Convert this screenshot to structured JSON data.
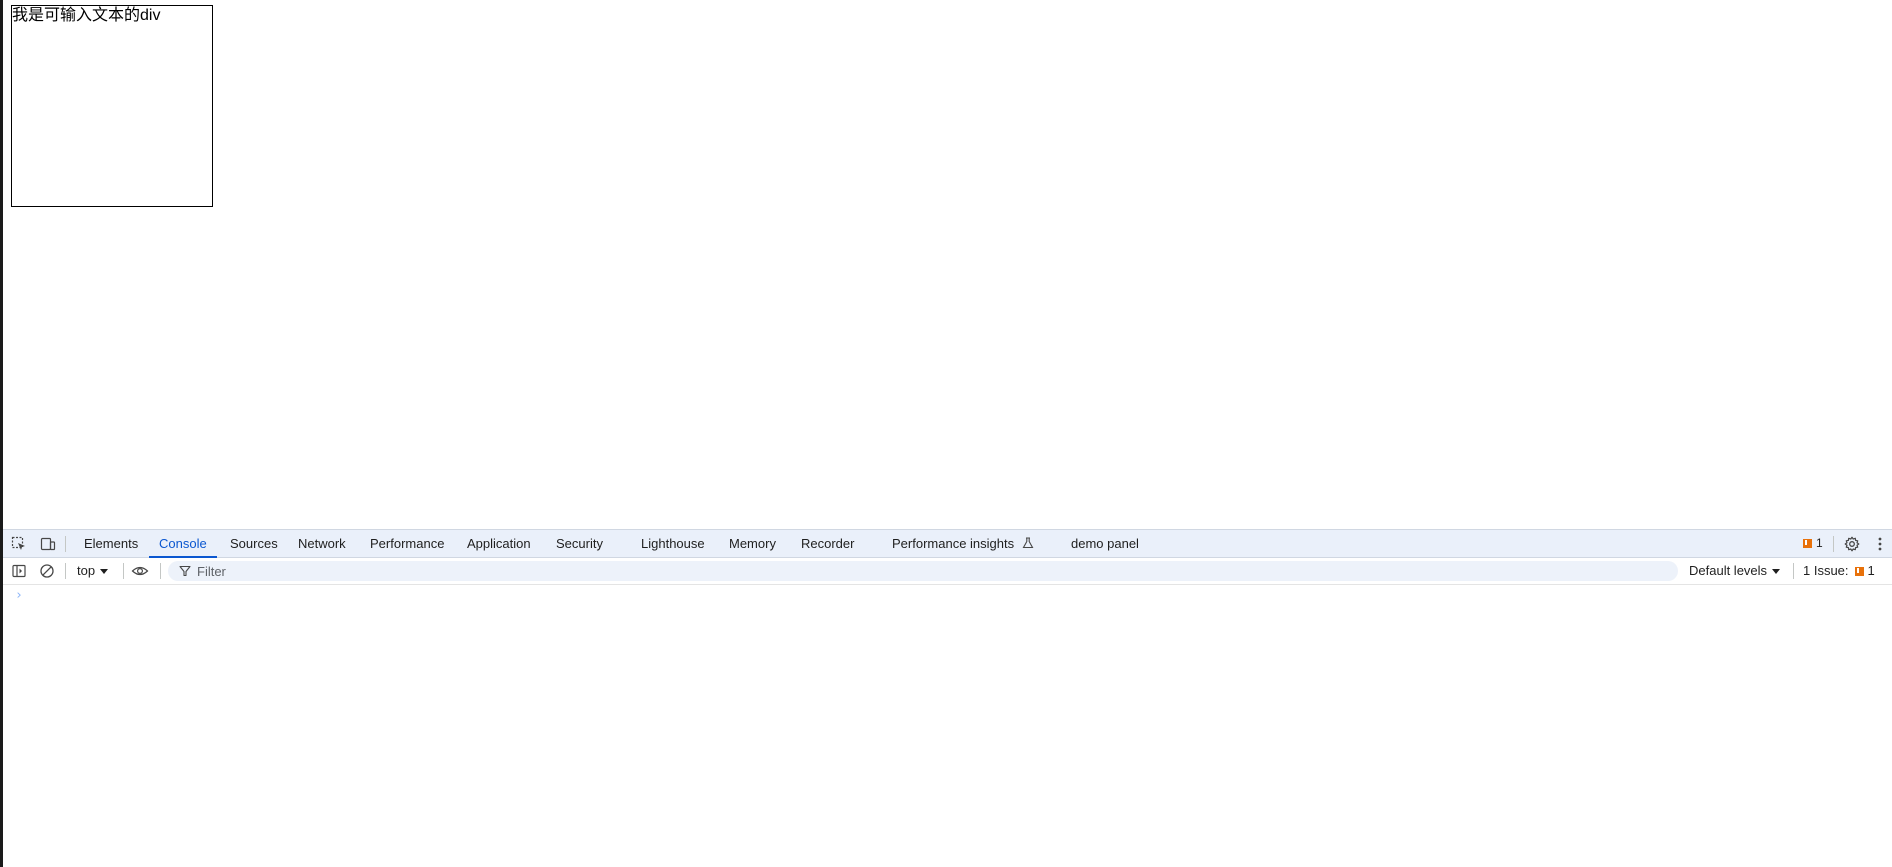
{
  "page": {
    "editable_div_text": "我是可输入文本的div"
  },
  "devtools": {
    "tabs": [
      {
        "label": "Elements"
      },
      {
        "label": "Console",
        "active": true
      },
      {
        "label": "Sources"
      },
      {
        "label": "Network"
      },
      {
        "label": "Performance"
      },
      {
        "label": "Application"
      },
      {
        "label": "Security"
      },
      {
        "label": "Lighthouse"
      },
      {
        "label": "Memory"
      },
      {
        "label": "Recorder"
      },
      {
        "label": "Performance insights",
        "icon": "flask-icon"
      },
      {
        "label": "demo panel"
      }
    ],
    "issue_count_badge": "1",
    "toolbar": {
      "context": "top",
      "filter_placeholder": "Filter",
      "levels": "Default levels",
      "issues_label": "1 Issue:",
      "issues_count": "1"
    },
    "prompt_symbol": "›",
    "accent_color": "#0b57d0",
    "warning_color": "#e8710a"
  }
}
